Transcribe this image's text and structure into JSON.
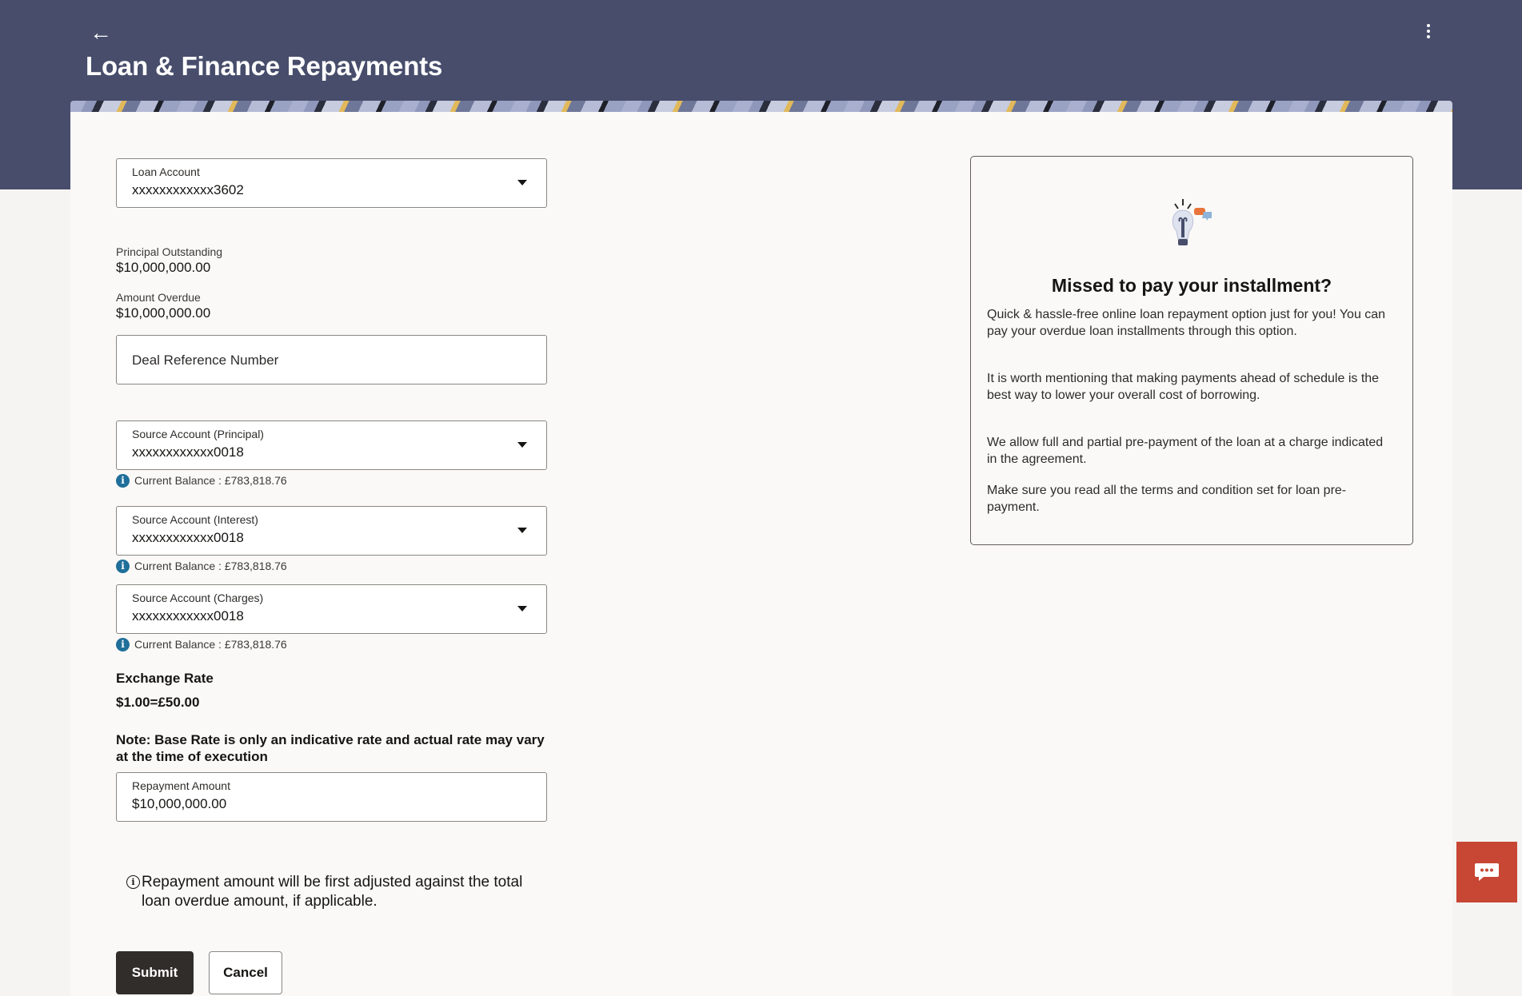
{
  "header": {
    "title": "Loan & Finance Repayments",
    "back_label": "←"
  },
  "form": {
    "loan_account": {
      "label": "Loan Account",
      "value": "xxxxxxxxxxxx3602"
    },
    "principal_outstanding": {
      "label": "Principal Outstanding",
      "value": "$10,000,000.00"
    },
    "amount_overdue": {
      "label": "Amount Overdue",
      "value": "$10,000,000.00"
    },
    "deal_reference": {
      "placeholder": "Deal Reference Number"
    },
    "source_principal": {
      "label": "Source Account (Principal)",
      "value": "xxxxxxxxxxxx0018",
      "balance": "Current Balance : £783,818.76"
    },
    "source_interest": {
      "label": "Source Account (Interest)",
      "value": "xxxxxxxxxxxx0018",
      "balance": "Current Balance : £783,818.76"
    },
    "source_charges": {
      "label": "Source Account (Charges)",
      "value": "xxxxxxxxxxxx0018",
      "balance": "Current Balance : £783,818.76"
    },
    "exchange_rate": {
      "label": "Exchange Rate",
      "value": "$1.00=£50.00"
    },
    "note": "Note: Base Rate is only an indicative rate and actual rate may vary at the time of execution",
    "repayment_amount": {
      "label": "Repayment Amount",
      "value": "$10,000,000.00"
    },
    "adjust_note": "Repayment amount will be first adjusted against the total loan overdue amount, if applicable.",
    "submit_label": "Submit",
    "cancel_label": "Cancel"
  },
  "promo": {
    "title": "Missed to pay your installment?",
    "paragraphs": [
      "Quick & hassle-free online loan repayment option just for you! You can pay your overdue loan installments through this option.",
      "It is worth mentioning that making payments ahead of schedule is the best way to lower your overall cost of borrowing.",
      "We allow full and partial pre-payment of the loan at a charge indicated in the agreement.",
      "Make sure you read all the terms and condition set for loan pre-payment."
    ]
  },
  "colors": {
    "header_bg": "#474d6b",
    "primary_button": "#312d2a",
    "chat_button": "#c74634",
    "info_icon": "#1f6f9a"
  }
}
